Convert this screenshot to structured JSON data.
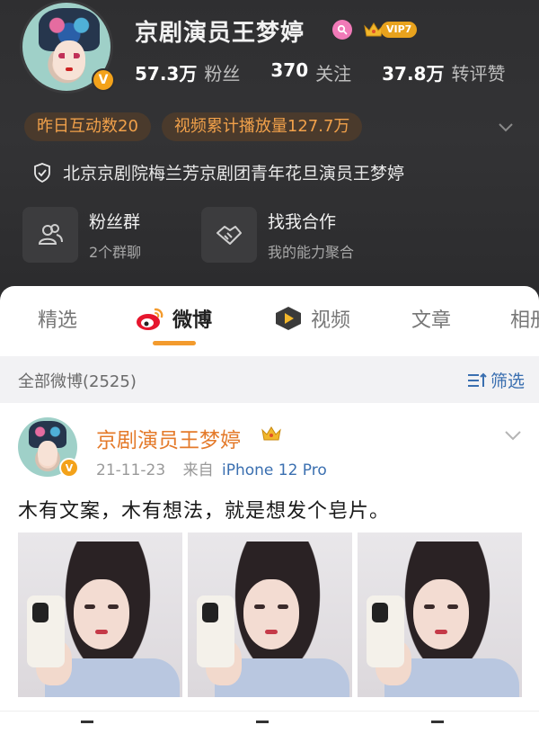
{
  "profile": {
    "name": "京剧演员王梦婷",
    "vip_label": "VIP7",
    "verified_mark": "V",
    "stats": [
      {
        "value": "57.3万",
        "label": "粉丝"
      },
      {
        "value": "370",
        "label": "关注"
      },
      {
        "value": "37.8万",
        "label": "转评赞"
      }
    ],
    "pills": [
      "昨日互动数20",
      "视频累计播放量127.7万"
    ],
    "certification": "北京京剧院梅兰芳京剧团青年花旦演员王梦婷",
    "cards": [
      {
        "title": "粉丝群",
        "subtitle": "2个群聊",
        "icon": "fans-group-icon"
      },
      {
        "title": "找我合作",
        "subtitle": "我的能力聚合",
        "icon": "handshake-icon"
      }
    ]
  },
  "tabs": [
    {
      "label": "精选",
      "active": false
    },
    {
      "label": "微博",
      "active": true
    },
    {
      "label": "视频",
      "active": false
    },
    {
      "label": "文章",
      "active": false
    },
    {
      "label": "相册",
      "active": false
    }
  ],
  "filter": {
    "count_label": "全部微博(2525)",
    "button_label": "筛选"
  },
  "post": {
    "author": "京剧演员王梦婷",
    "date": "21-11-23",
    "source_prefix": "来自",
    "source": "iPhone 12 Pro",
    "text": "木有文案，木有想法，就是想发个皂片。",
    "photo_count": 3
  },
  "colors": {
    "header_bg": "#2f2f31",
    "pill_text": "#f0a04a",
    "accent_orange": "#f39b2d",
    "link_blue": "#3a6fb0",
    "vip_gold": "#e8a21d"
  }
}
